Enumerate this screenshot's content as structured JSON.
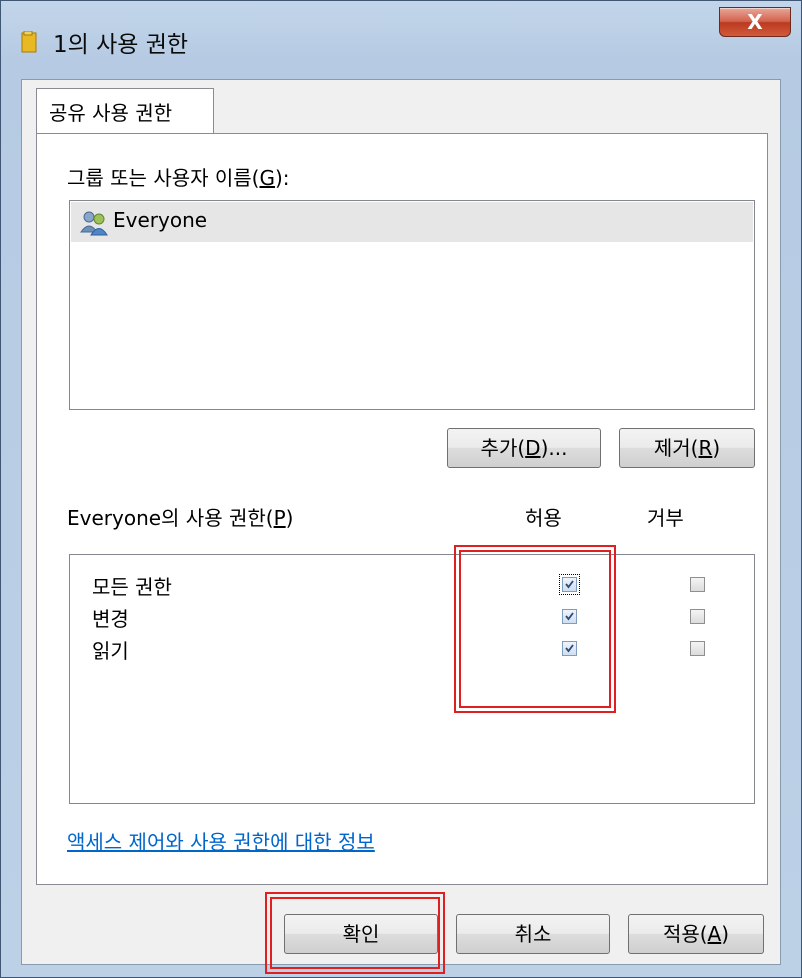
{
  "window": {
    "title": "1의 사용 권한",
    "close_label": "X"
  },
  "tabs": [
    {
      "label": "공유 사용 권한"
    }
  ],
  "group": {
    "label_prefix": "그룹 또는 사용자 이름(",
    "label_mnemonic": "G",
    "label_suffix": "):",
    "users": [
      {
        "name": "Everyone",
        "icon": "users-group-icon",
        "selected": true
      }
    ]
  },
  "buttons": {
    "add_prefix": "추가(",
    "add_mnemonic": "D",
    "add_suffix": ")...",
    "remove_prefix": "제거(",
    "remove_mnemonic": "R",
    "remove_suffix": ")"
  },
  "permissions": {
    "label_prefix": "Everyone의 사용 권한(",
    "label_mnemonic": "P",
    "label_suffix": ")",
    "allow_header": "허용",
    "deny_header": "거부",
    "rows": [
      {
        "name": "모든 권한",
        "allow": true,
        "deny": false
      },
      {
        "name": "변경",
        "allow": true,
        "deny": false
      },
      {
        "name": "읽기",
        "allow": true,
        "deny": false
      }
    ]
  },
  "link": {
    "text": "액세스 제어와 사용 권한에 대한 정보"
  },
  "footer": {
    "ok": "확인",
    "cancel": "취소",
    "apply_prefix": "적용(",
    "apply_mnemonic": "A",
    "apply_suffix": ")"
  },
  "colors": {
    "highlight": "#e02020",
    "link": "#0066cc"
  }
}
